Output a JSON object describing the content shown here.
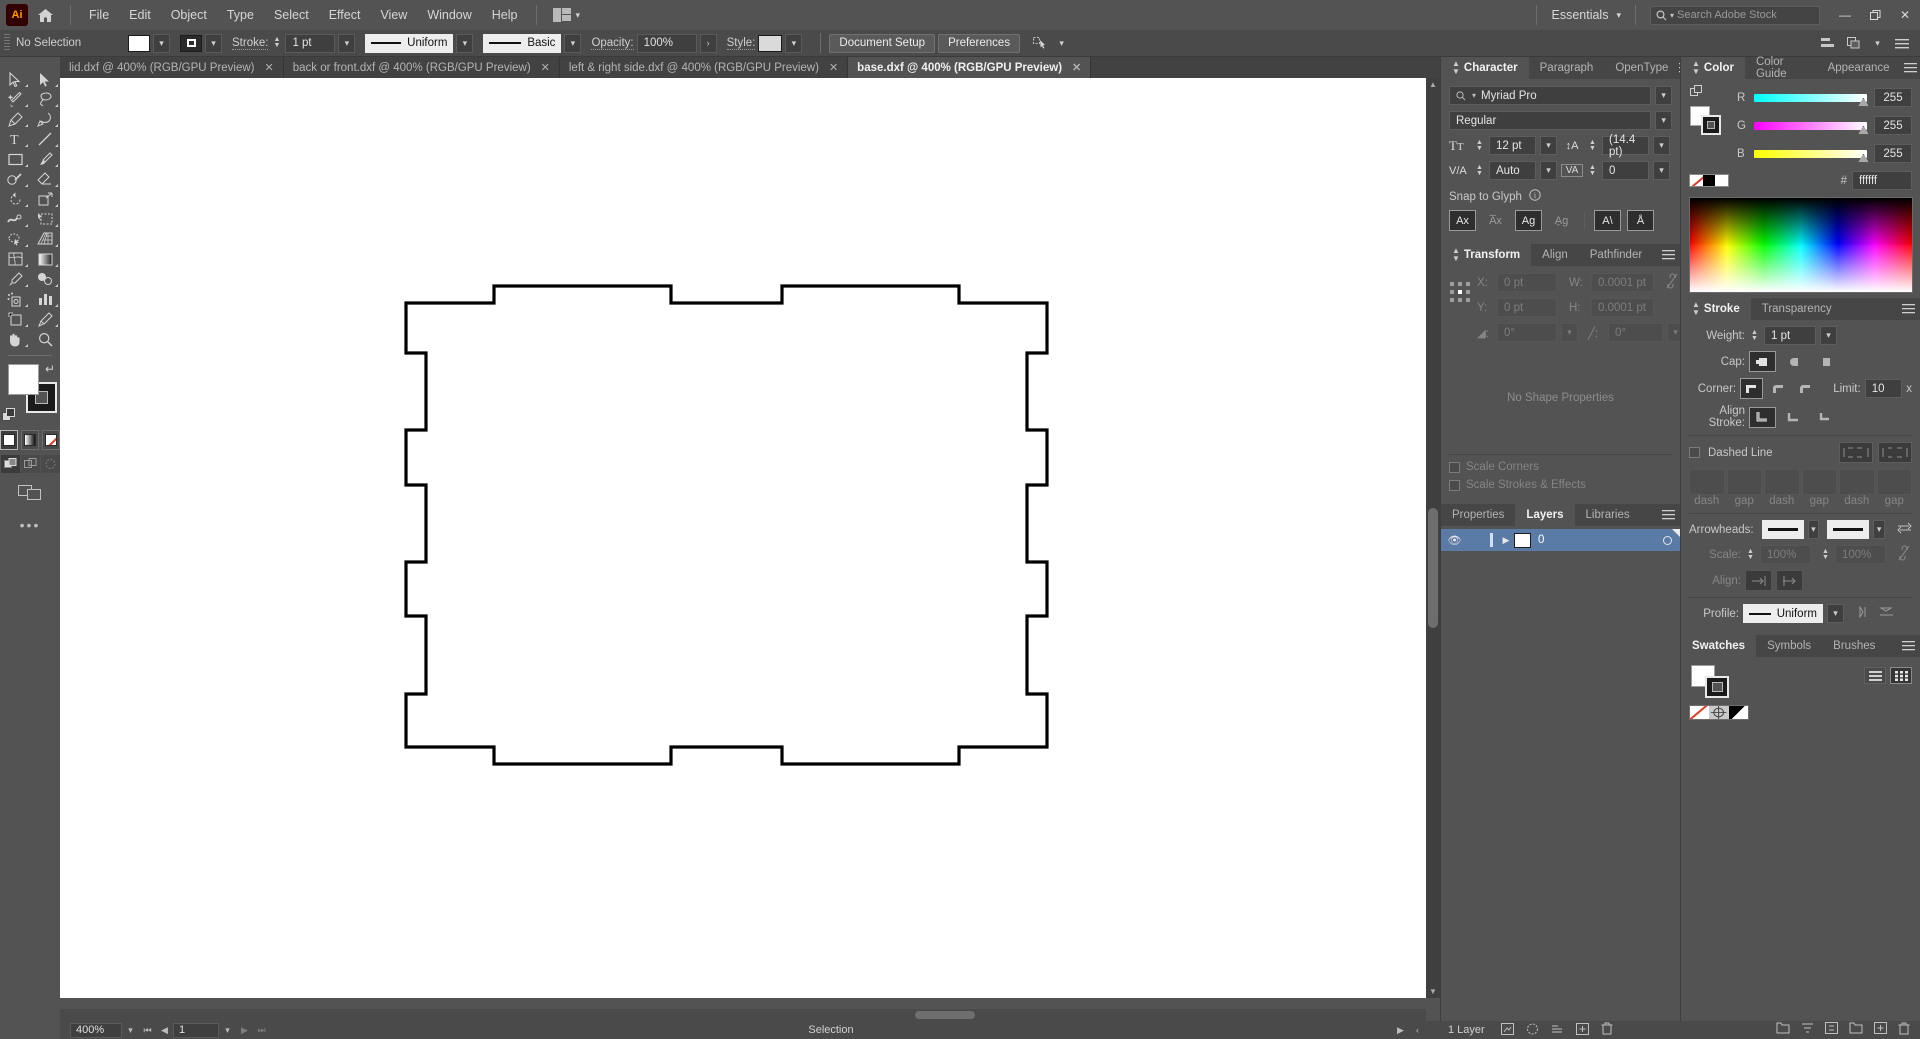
{
  "app": {
    "name": "Ai",
    "logo_text": "Ai"
  },
  "menubar": {
    "items": [
      "File",
      "Edit",
      "Object",
      "Type",
      "Select",
      "Effect",
      "View",
      "Window",
      "Help"
    ],
    "workspace": "Essentials",
    "search_placeholder": "Search Adobe Stock",
    "window_buttons": {
      "minimize": "—",
      "restore": "❐",
      "close": "✕"
    }
  },
  "controlbar": {
    "selection_status": "No Selection",
    "stroke_label": "Stroke:",
    "stroke_weight": "1 pt",
    "profile_value": "Uniform",
    "brush_value": "Basic",
    "opacity_label": "Opacity:",
    "opacity_value": "100%",
    "style_label": "Style:",
    "document_setup": "Document Setup",
    "preferences": "Preferences"
  },
  "tabs": [
    {
      "label": "lid.dxf @ 400% (RGB/GPU Preview)",
      "active": false,
      "close": "✕"
    },
    {
      "label": "back or front.dxf @ 400% (RGB/GPU Preview)",
      "active": false,
      "close": "✕"
    },
    {
      "label": "left & right side.dxf @ 400% (RGB/GPU Preview)",
      "active": false,
      "close": "✕"
    },
    {
      "label": "base.dxf @ 400% (RGB/GPU Preview)",
      "active": true,
      "close": "✕"
    }
  ],
  "toolbar": {
    "tools": [
      "selection-tool",
      "direct-selection-tool",
      "magic-wand-tool",
      "lasso-tool",
      "pen-tool",
      "curvature-tool",
      "type-tool",
      "line-segment-tool",
      "rectangle-tool",
      "paintbrush-tool",
      "shaper-tool",
      "eraser-tool",
      "rotate-tool",
      "scale-tool",
      "width-tool",
      "free-transform-tool",
      "shape-builder-tool",
      "perspective-grid-tool",
      "mesh-tool",
      "gradient-tool",
      "eyedropper-tool",
      "blend-tool",
      "symbol-sprayer-tool",
      "column-graph-tool",
      "artboard-tool",
      "slice-tool",
      "hand-tool",
      "zoom-tool"
    ],
    "fill_color": "#ffffff",
    "stroke_color": "#000000",
    "more_tools": "•••"
  },
  "canvas": {
    "background": "#ffffff",
    "artwork_name": "base-dxf-outline-path",
    "stroke_color": "#000000"
  },
  "statusbar": {
    "zoom": "400%",
    "page": "1",
    "tool_status": "Selection"
  },
  "panels": {
    "character": {
      "tabs": [
        "Character",
        "Paragraph",
        "OpenType"
      ],
      "active_tab": "Character",
      "font_family": "Myriad Pro",
      "font_style": "Regular",
      "font_size": "12 pt",
      "leading": "(14.4 pt)",
      "kerning": "Auto",
      "tracking": "0",
      "snap_to_glyph_label": "Snap to Glyph",
      "glyph_buttons": [
        "Ax",
        "A̅x",
        "Ag",
        "A̱g",
        "A\\",
        "Å"
      ]
    },
    "transform": {
      "tabs": [
        "Transform",
        "Align",
        "Pathfinder"
      ],
      "active_tab": "Transform",
      "x_label": "X:",
      "x_value": "0 pt",
      "y_label": "Y:",
      "y_value": "0 pt",
      "w_label": "W:",
      "w_value": "0.0001 pt",
      "h_label": "H:",
      "h_value": "0.0001 pt",
      "rotate_value": "0°",
      "shear_value": "0°",
      "no_shape_properties": "No Shape Properties",
      "scale_corners": "Scale Corners",
      "scale_strokes": "Scale Strokes & Effects"
    },
    "layers": {
      "tabs": [
        "Properties",
        "Layers",
        "Libraries"
      ],
      "active_tab": "Layers",
      "rows": [
        {
          "name": "0",
          "visible": true,
          "selected": true
        }
      ],
      "footer_count": "1 Layer"
    },
    "color": {
      "tabs": [
        "Color",
        "Color Guide",
        "Appearance"
      ],
      "active_tab": "Color",
      "channels": [
        {
          "label": "R",
          "value": "255",
          "from": "#00ffff",
          "to": "#ffffff"
        },
        {
          "label": "G",
          "value": "255",
          "from": "#ff00ff",
          "to": "#ffffff"
        },
        {
          "label": "B",
          "value": "255",
          "from": "#ffff00",
          "to": "#ffffff"
        }
      ],
      "hex_label": "#",
      "hex_value": "ffffff"
    },
    "stroke": {
      "tabs": [
        "Stroke",
        "Transparency"
      ],
      "active_tab": "Stroke",
      "weight_label": "Weight:",
      "weight_value": "1 pt",
      "cap_label": "Cap:",
      "corner_label": "Corner:",
      "limit_label": "Limit:",
      "limit_value": "10",
      "limit_unit": "x",
      "align_stroke_label": "Align Stroke:",
      "dashed_line_label": "Dashed Line",
      "dash_fields": [
        "dash",
        "gap",
        "dash",
        "gap",
        "dash",
        "gap"
      ],
      "arrowheads_label": "Arrowheads:",
      "scale_label": "Scale:",
      "scale_values": [
        "100%",
        "100%"
      ],
      "align_label": "Align:",
      "profile_label": "Profile:",
      "profile_value": "Uniform"
    },
    "swatches": {
      "tabs": [
        "Swatches",
        "Symbols",
        "Brushes"
      ],
      "active_tab": "Swatches",
      "swatch_names": [
        "none-swatch",
        "registration-swatch",
        "black-white-swatch"
      ]
    }
  }
}
